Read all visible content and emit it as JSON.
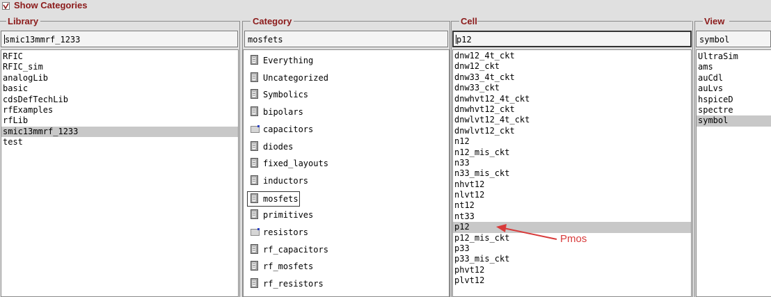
{
  "header": {
    "show_categories_label": "Show Categories",
    "show_categories_checked": true
  },
  "columns": {
    "library": {
      "title": "Library",
      "filter_value": "smic13mmrf_1233",
      "items": [
        "RFIC",
        "RFIC_sim",
        "analogLib",
        "basic",
        "cdsDefTechLib",
        "rfExamples",
        "rfLib",
        "smic13mmrf_1233",
        "test"
      ],
      "selected": "smic13mmrf_1233"
    },
    "category": {
      "title": "Category",
      "filter_value": "mosfets",
      "items": [
        {
          "label": "Everything",
          "icon": "book-icon"
        },
        {
          "label": "Uncategorized",
          "icon": "book-icon"
        },
        {
          "label": "Symbolics",
          "icon": "book-icon"
        },
        {
          "label": "bipolars",
          "icon": "book-icon"
        },
        {
          "label": "capacitors",
          "icon": "folder-icon"
        },
        {
          "label": "diodes",
          "icon": "book-icon"
        },
        {
          "label": "fixed_layouts",
          "icon": "book-icon"
        },
        {
          "label": "inductors",
          "icon": "book-icon"
        },
        {
          "label": "mosfets",
          "icon": "book-icon"
        },
        {
          "label": "primitives",
          "icon": "book-icon"
        },
        {
          "label": "resistors",
          "icon": "folder-icon"
        },
        {
          "label": "rf_capacitors",
          "icon": "book-icon"
        },
        {
          "label": "rf_mosfets",
          "icon": "book-icon"
        },
        {
          "label": "rf_resistors",
          "icon": "book-icon"
        }
      ],
      "selected": "mosfets"
    },
    "cell": {
      "title": "Cell",
      "filter_value": "p12",
      "items": [
        "dnw12_4t_ckt",
        "dnw12_ckt",
        "dnw33_4t_ckt",
        "dnw33_ckt",
        "dnwhvt12_4t_ckt",
        "dnwhvt12_ckt",
        "dnwlvt12_4t_ckt",
        "dnwlvt12_ckt",
        "n12",
        "n12_mis_ckt",
        "n33",
        "n33_mis_ckt",
        "nhvt12",
        "nlvt12",
        "nt12",
        "nt33",
        "p12",
        "p12_mis_ckt",
        "p33",
        "p33_mis_ckt",
        "phvt12",
        "plvt12"
      ],
      "selected": "p12"
    },
    "view": {
      "title": "View",
      "filter_value": "symbol",
      "items": [
        "UltraSim",
        "ams",
        "auCdl",
        "auLvs",
        "hspiceD",
        "spectre",
        "symbol"
      ],
      "selected": "symbol"
    }
  },
  "annotation": {
    "text": "Pmos",
    "color": "#d83a3a"
  },
  "colors": {
    "title": "#8b1a1a",
    "selection": "#c8c8c8"
  }
}
